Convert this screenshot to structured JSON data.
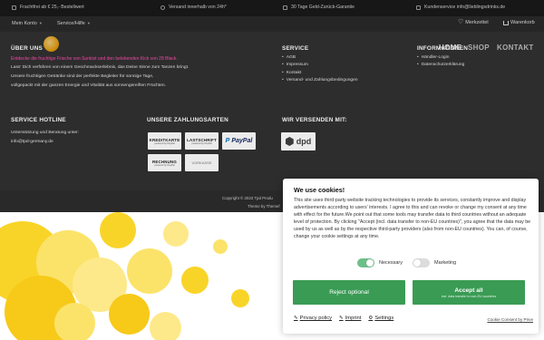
{
  "topbar": {
    "items": [
      {
        "icon": "truck-icon",
        "text": "Frachtfrei ab € 25,- Bestellwert"
      },
      {
        "icon": "clock-icon",
        "text": "Versand innerhalb von 24h*"
      },
      {
        "icon": "shield-icon",
        "text": "30 Tage Geld-Zurück-Garantie"
      },
      {
        "icon": "mail-icon",
        "text": "Kundenservice info@lieblingsdrinks.de"
      }
    ]
  },
  "navbar": {
    "account_label": "Mein Konto",
    "service_label": "Service/Hilfe",
    "wishlist_label": "Merkzettel",
    "cart_label": "Warenkorb"
  },
  "top_menu": [
    "HOME",
    "SHOP",
    "KONTAKT"
  ],
  "footer": {
    "about": {
      "heading": "ÜBER UNS",
      "ribbon": "Entdecke die fruchtige Frische von Sunkist und den belebenden Kick von 28 Black.",
      "lines": [
        "Lass' Dich verführen von einem Geschmackserlebnis, das Deine Sinne zum Tanzen bringt.",
        "Unsere fruchtigen Getränke sind der perfekte Begleiter für sonnige Tage,",
        "vollgepackt mit der ganzen Energie und Vitalität aus sonnengereiften Früchten."
      ]
    },
    "service": {
      "heading": "SERVICE",
      "items": [
        "AGB",
        "Impressum",
        "Kontakt",
        "Versand- und Zahlungsbedingungen"
      ]
    },
    "information": {
      "heading": "INFORMATIONEN",
      "items": [
        "Händler-Login",
        "Datenschutzerklärung"
      ]
    },
    "hotline": {
      "heading": "SERVICE HOTLINE",
      "lines": [
        "Unterstützung und Beratung unter:",
        "info@tpd-germany.de"
      ]
    },
    "payment": {
      "heading": "UNSERE ZAHLUNGSARTEN",
      "badges": [
        {
          "big": "KREDITKARTE",
          "small": "powered by PayPal"
        },
        {
          "big": "LASTSCHRIFT",
          "small": "powered by PayPal"
        },
        {
          "big": "PayPal",
          "small": ""
        },
        {
          "big": "RECHNUNG",
          "small": "powered by PayPal"
        },
        {
          "big": "VORKASSE",
          "small": ""
        }
      ]
    },
    "shipping": {
      "heading": "WIR VERSENDEN MIT:",
      "carrier": "dpd"
    },
    "copyright": "Copyright © 2023 Tpd Produ",
    "theme_by": "Theme by Themef"
  },
  "cookie": {
    "title": "We use cookies!",
    "text": "This site uses third-party website tracking technologies to provide its services, constantly improve and display advertisements according to users' interests. I agree to this and can revoke or change my consent at any time with effect for the future.We point out that some tools may transfer data to third countries without an adequate level of protection. By clicking \"Accept (incl. data transfer to non-EU countries)\", you agree that the data may be used by us as well as by the respective third-party providers (also from non-EU countries). You can, of course, change your cookie settings at any time.",
    "necessary_label": "Necessary",
    "necessary_on": true,
    "marketing_label": "Marketing",
    "marketing_on": false,
    "reject_label": "Reject optional",
    "accept_label": "Accept all",
    "accept_sub": "incl. data transfer to non-EU countries",
    "links": {
      "privacy": "Privacy policy",
      "imprint": "Imprint",
      "settings": "Settings"
    },
    "credit": "Cookie Consent by Prive"
  },
  "colors": {
    "accept_button": "#3a9b54",
    "toggle_on": "#6dbf89",
    "footer_bg": "#313131",
    "topbar_bg": "#1a1a1a",
    "ribbon_pink": "#ff4fb0",
    "bubble_yellow": "#f7c919"
  }
}
